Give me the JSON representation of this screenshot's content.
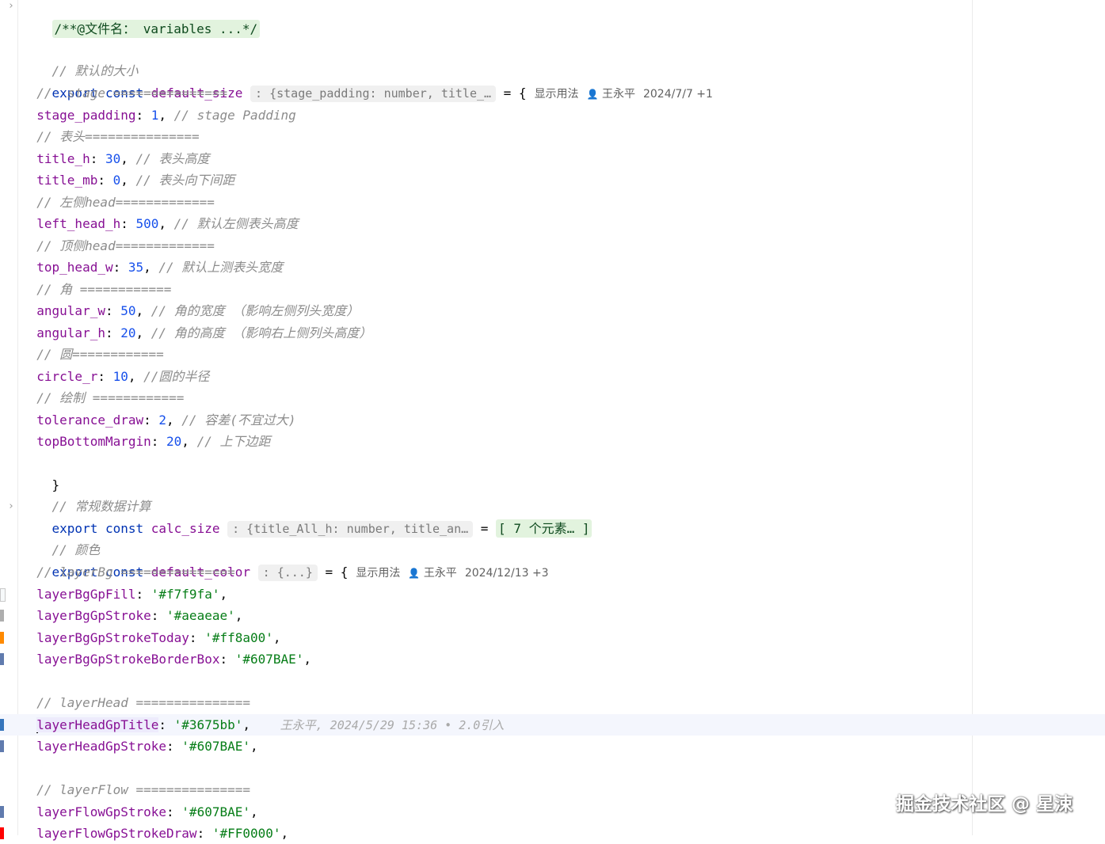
{
  "editor": {
    "header_comment": "/**@文件名： variables ...*/",
    "c_default_size": "// 默认的大小",
    "default_size": {
      "kw1": "export",
      "kw2": "const",
      "name": "default_size",
      "type_hint": ": {stage_padding: number, title_…",
      "assign": " = {",
      "usages": "显示用法",
      "author": "王永平",
      "date": "2024/7/7 +1"
    },
    "lines_default_size": [
      {
        "comment": "//  stage ==============="
      },
      {
        "key": "stage_padding",
        "value": "1",
        "comment": "// stage Padding"
      },
      {
        "comment": "// 表头==============="
      },
      {
        "key": "title_h",
        "value": "30",
        "comment": "// 表头高度"
      },
      {
        "key": "title_mb",
        "value": "0",
        "comment": "// 表头向下间距"
      },
      {
        "comment": "// 左侧head============="
      },
      {
        "key": "left_head_h",
        "value": "500",
        "comment": "// 默认左侧表头高度"
      },
      {
        "comment": "// 顶侧head============="
      },
      {
        "key": "top_head_w",
        "value": "35",
        "comment": "// 默认上测表头宽度"
      },
      {
        "comment": "// 角 ============"
      },
      {
        "key": "angular_w",
        "value": "50",
        "comment": "// 角的宽度 （影响左侧列头宽度）"
      },
      {
        "key": "angular_h",
        "value": "20",
        "comment": "// 角的高度 （影响右上侧列头高度）"
      },
      {
        "comment": "// 圆============"
      },
      {
        "key": "circle_r",
        "value": "10",
        "comment": "//圆的半径"
      },
      {
        "comment": "// 绘制 ============"
      },
      {
        "key": "tolerance_draw",
        "value": "2",
        "comment": "// 容差(不宜过大)"
      },
      {
        "key": "topBottomMargin",
        "value": "20",
        "comment": "// 上下边距"
      }
    ],
    "close_brace": "}",
    "c_calc": "// 常规数据计算",
    "calc_size": {
      "kw1": "export",
      "kw2": "const",
      "name": "calc_size",
      "type_hint": ": {title_All_h: number, title_an…",
      "assign": " = ",
      "folded": "[ 7 个元素… ]"
    },
    "c_color": "// 颜色",
    "default_color": {
      "kw1": "export",
      "kw2": "const",
      "name": "default_color",
      "type_hint": ": {...}",
      "assign": " = {",
      "usages": "显示用法",
      "author": "王永平",
      "date": "2024/12/13 +3"
    },
    "lines_color": [
      {
        "comment": "// layerBg ==============="
      },
      {
        "key": "layerBgGpFill",
        "value": "'#f7f9fa'",
        "marker": "#f7f9fa"
      },
      {
        "key": "layerBgGpStroke",
        "value": "'#aeaeae'",
        "marker": "#aeaeae"
      },
      {
        "key": "layerBgGpStrokeToday",
        "value": "'#ff8a00'",
        "marker": "#ff8a00"
      },
      {
        "key": "layerBgGpStrokeBorderBox",
        "value": "'#607BAE'",
        "marker": "#607BAE"
      },
      {},
      {
        "comment": "// layerHead ==============="
      },
      {
        "key": "layerHeadGpTitle",
        "value": "'#3675bb'",
        "marker": "#3675bb",
        "blame": "王永平, 2024/5/29 15:36 • 2.0引入"
      },
      {
        "key": "layerHeadGpStroke",
        "value": "'#607BAE'",
        "marker": "#607BAE"
      },
      {},
      {
        "comment": "// layerFlow ==============="
      },
      {
        "key": "layerFlowGpStroke",
        "value": "'#607BAE'",
        "marker": "#607BAE"
      },
      {
        "key": "layerFlowGpStrokeDraw",
        "value": "'#FF0000'",
        "marker": "#FF0000"
      }
    ]
  },
  "watermark": "掘金技术社区 @ 星涑"
}
